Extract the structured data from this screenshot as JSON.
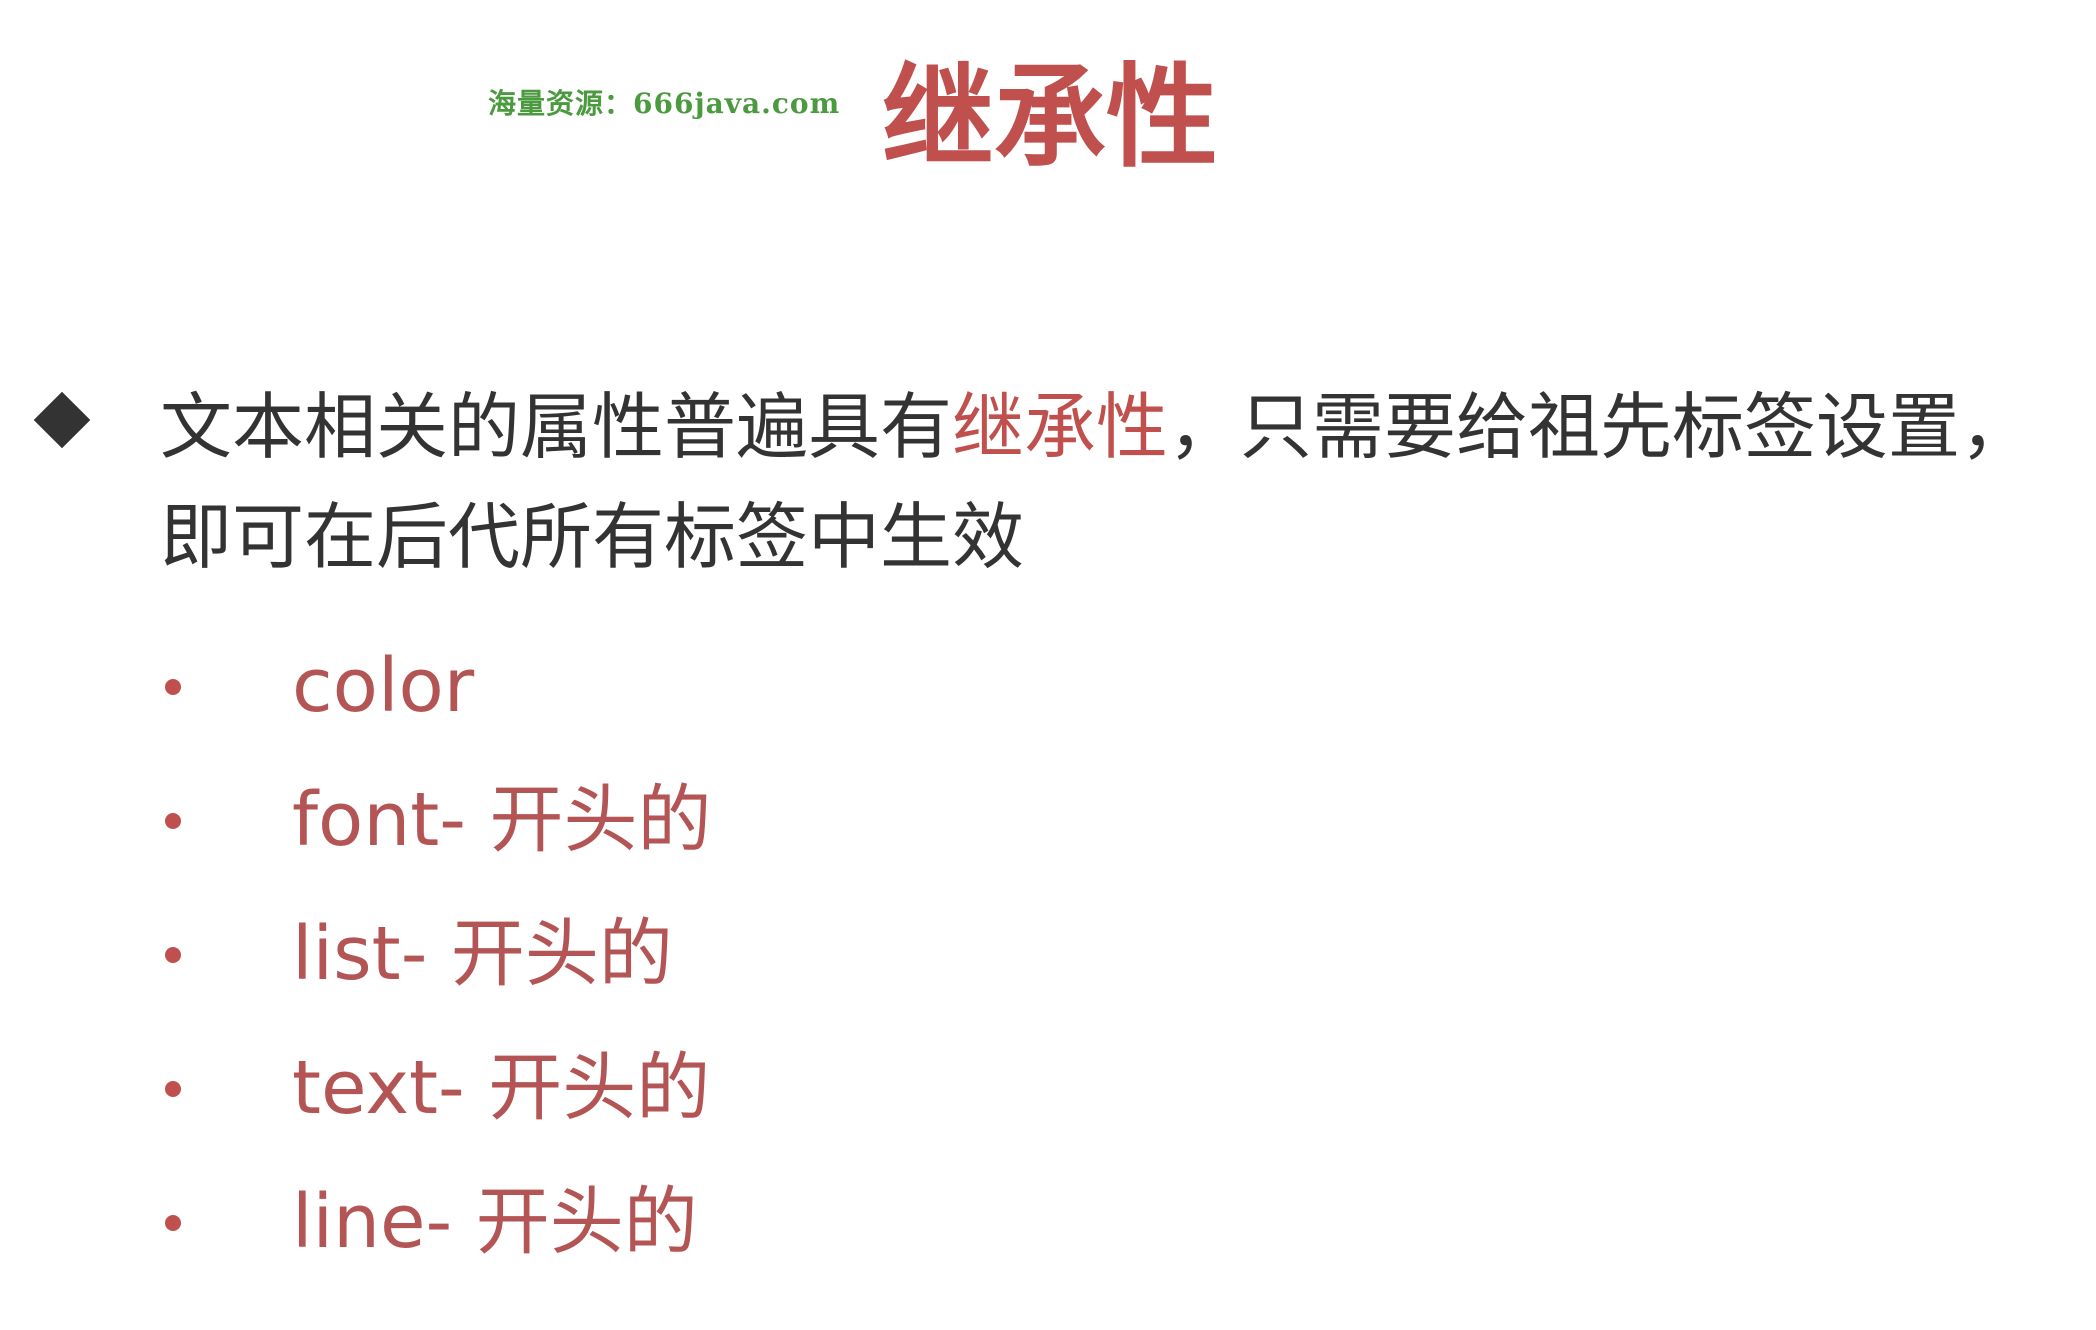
{
  "watermark": "海量资源：666java.com",
  "title": "继承性",
  "main_point": {
    "icon": "diamond-bullet-icon",
    "line1_before": "文本相关的属性普遍具有",
    "line1_highlight": "继承性",
    "line1_after": "，只需要给祖先标签设置，",
    "line2": "即可在后代所有标签中生效"
  },
  "sub_items": [
    {
      "label": "color"
    },
    {
      "label": "font- 开头的"
    },
    {
      "label": "list- 开头的"
    },
    {
      "label": "text- 开头的"
    },
    {
      "label": "line- 开头的"
    }
  ],
  "colors": {
    "title": "#c0504d",
    "accent": "#c0504d",
    "body_text": "#333333",
    "watermark": "#4b9a3f"
  }
}
